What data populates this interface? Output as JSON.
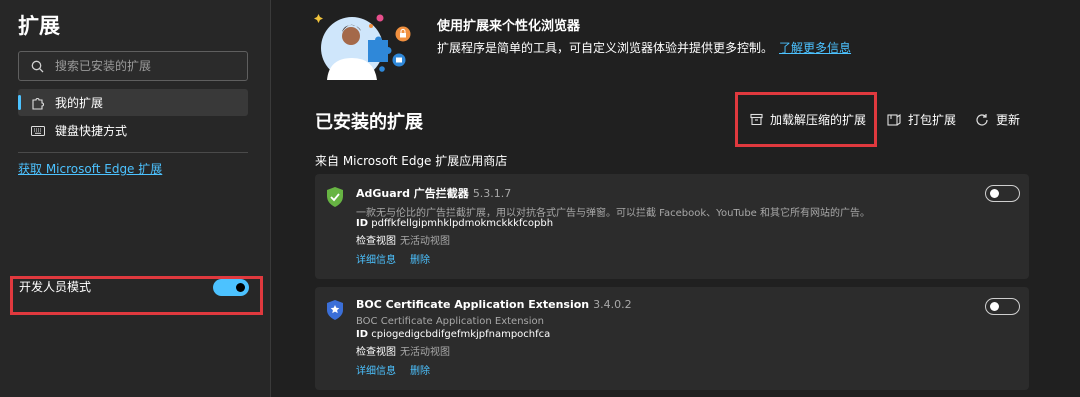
{
  "sidebar": {
    "title": "扩展",
    "search_placeholder": "搜索已安装的扩展",
    "nav": [
      {
        "label": "我的扩展",
        "icon": "puzzle-icon",
        "active": true
      },
      {
        "label": "键盘快捷方式",
        "icon": "keyboard-icon",
        "active": false
      }
    ],
    "get_link": "获取 Microsoft Edge 扩展",
    "developer_mode": {
      "label": "开发人员模式",
      "enabled": true
    }
  },
  "hero": {
    "title": "使用扩展来个性化浏览器",
    "description": "扩展程序是简单的工具，可自定义浏览器体验并提供更多控制。",
    "link": "了解更多信息"
  },
  "installed": {
    "title": "已安装的扩展",
    "actions": {
      "load_unpacked": "加载解压缩的扩展",
      "pack": "打包扩展",
      "update": "更新"
    },
    "source_label": "来自 Microsoft Edge 扩展应用商店",
    "extensions": [
      {
        "name": "AdGuard 广告拦截器",
        "version": "5.3.1.7",
        "description": "一款无与伦比的广告拦截扩展，用以对抗各式广告与弹窗。可以拦截 Facebook、YouTube 和其它所有网站的广告。",
        "id_label": "ID",
        "id": "pdffkfellgipmhklpdmokmckkkfcopbh",
        "inspect_label": "检查视图",
        "inspect_value": "无活动视图",
        "details": "详细信息",
        "remove": "删除",
        "enabled": false,
        "icon": "shield-check-icon",
        "color": "#67b443"
      },
      {
        "name": "BOC Certificate Application Extension",
        "version": "3.4.0.2",
        "description": "BOC Certificate Application Extension",
        "id_label": "ID",
        "id": "cpiogedigcbdifgefmkjpfnampochfca",
        "inspect_label": "检查视图",
        "inspect_value": "无活动视图",
        "details": "详细信息",
        "remove": "删除",
        "enabled": false,
        "icon": "badge-icon",
        "color": "#3b6fd8"
      }
    ]
  },
  "colors": {
    "accent": "#4cc2ff",
    "highlight": "#e0393e",
    "background": "#202020"
  }
}
